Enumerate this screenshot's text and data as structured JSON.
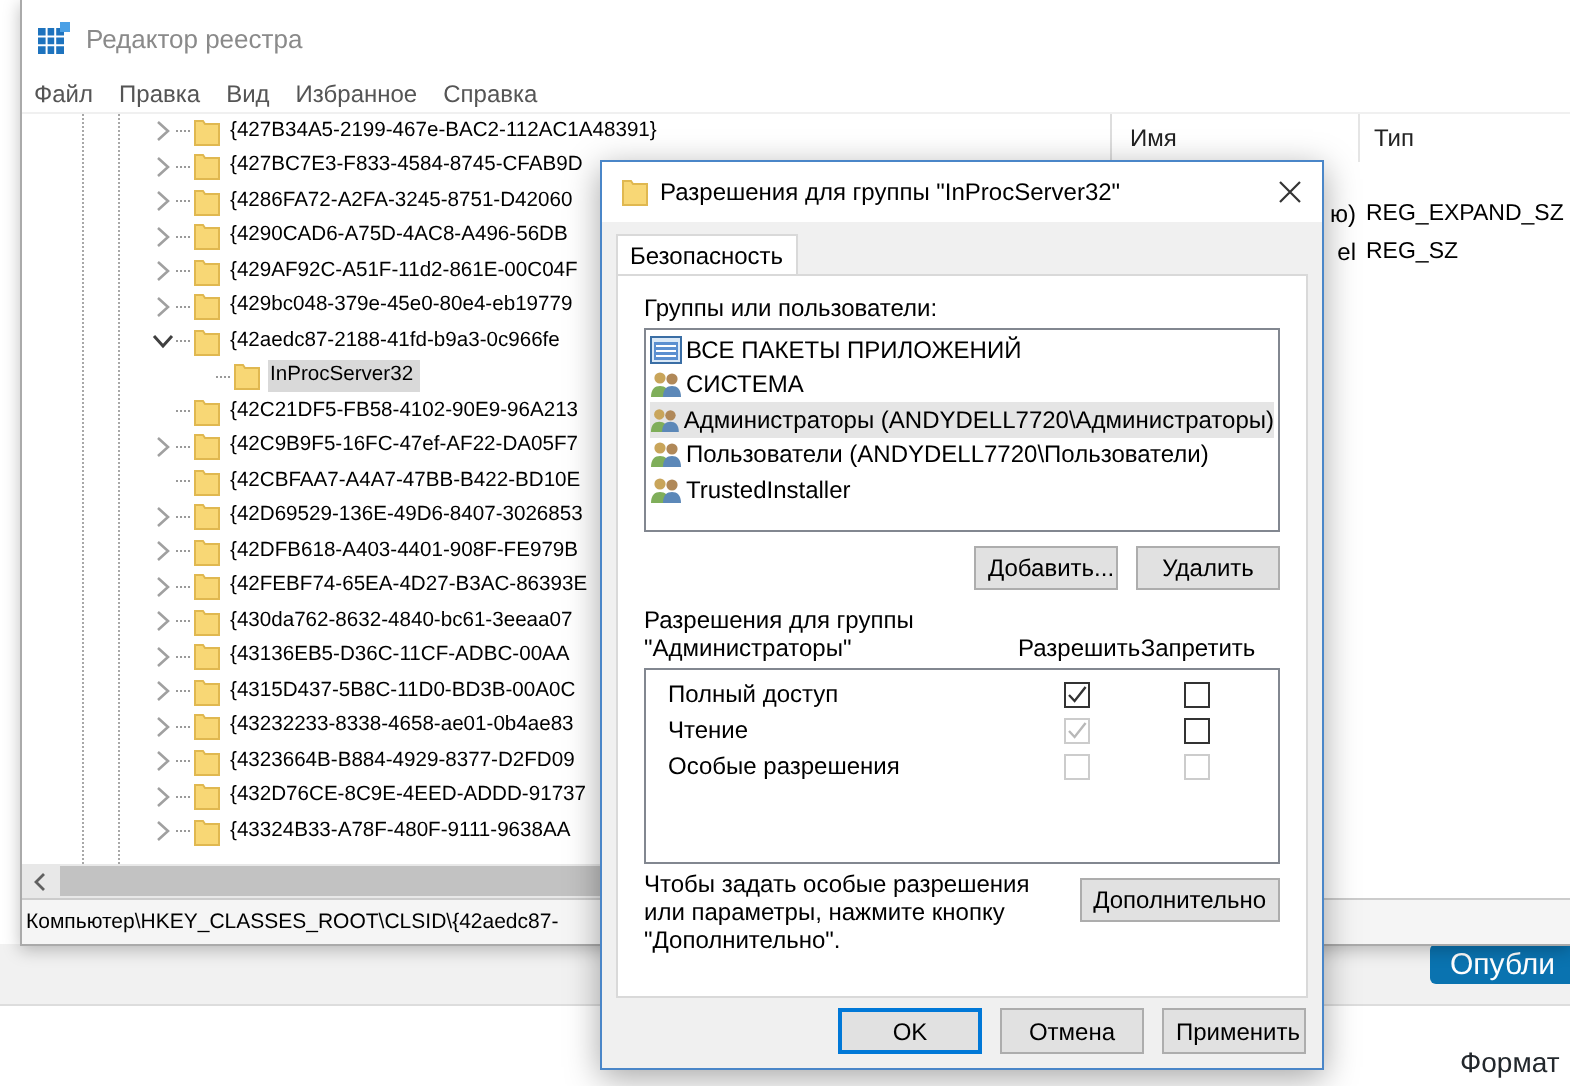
{
  "background_page": {
    "publish_button": "Опубли",
    "section_heading": "Формат"
  },
  "registry_window": {
    "title": "Редактор реестра",
    "menu": [
      "Файл",
      "Правка",
      "Вид",
      "Избранное",
      "Справка"
    ],
    "tree": [
      {
        "name": "{427B34A5-2199-467e-BAC2-112AC1A48391}",
        "expandable": true,
        "expanded": false,
        "selected": false
      },
      {
        "name": "{427BC7E3-F833-4584-8745-CFAB9D",
        "expandable": true,
        "expanded": false,
        "selected": false
      },
      {
        "name": "{4286FA72-A2FA-3245-8751-D42060",
        "expandable": true,
        "expanded": false,
        "selected": false
      },
      {
        "name": "{4290CAD6-A75D-4AC8-A496-56DB",
        "expandable": true,
        "expanded": false,
        "selected": false
      },
      {
        "name": "{429AF92C-A51F-11d2-861E-00C04F",
        "expandable": true,
        "expanded": false,
        "selected": false
      },
      {
        "name": "{429bc048-379e-45e0-80e4-eb19779",
        "expandable": true,
        "expanded": false,
        "selected": false
      },
      {
        "name": "{42aedc87-2188-41fd-b9a3-0c966fe",
        "expandable": true,
        "expanded": true,
        "selected": false,
        "children": [
          {
            "name": "InProcServer32",
            "expandable": false,
            "selected": true
          }
        ]
      },
      {
        "name": "{42C21DF5-FB58-4102-90E9-96A213",
        "expandable": false,
        "selected": false
      },
      {
        "name": "{42C9B9F5-16FC-47ef-AF22-DA05F7",
        "expandable": true,
        "expanded": false,
        "selected": false
      },
      {
        "name": "{42CBFAA7-A4A7-47BB-B422-BD10E",
        "expandable": false,
        "selected": false
      },
      {
        "name": "{42D69529-136E-49D6-8407-3026853",
        "expandable": true,
        "expanded": false,
        "selected": false
      },
      {
        "name": "{42DFB618-A403-4401-908F-FE979B",
        "expandable": true,
        "expanded": false,
        "selected": false
      },
      {
        "name": "{42FEBF74-65EA-4D27-B3AC-86393E",
        "expandable": true,
        "expanded": false,
        "selected": false
      },
      {
        "name": "{430da762-8632-4840-bc61-3eeaa07",
        "expandable": true,
        "expanded": false,
        "selected": false
      },
      {
        "name": "{43136EB5-D36C-11CF-ADBC-00AA",
        "expandable": true,
        "expanded": false,
        "selected": false
      },
      {
        "name": "{4315D437-5B8C-11D0-BD3B-00A0C",
        "expandable": true,
        "expanded": false,
        "selected": false
      },
      {
        "name": "{43232233-8338-4658-ae01-0b4ae83",
        "expandable": true,
        "expanded": false,
        "selected": false
      },
      {
        "name": "{4323664B-B884-4929-8377-D2FD09",
        "expandable": true,
        "expanded": false,
        "selected": false
      },
      {
        "name": "{432D76CE-8C9E-4EED-ADDD-91737",
        "expandable": true,
        "expanded": false,
        "selected": false
      },
      {
        "name": "{43324B33-A78F-480F-9111-9638AA",
        "expandable": true,
        "expanded": false,
        "selected": false
      }
    ],
    "values_table": {
      "columns": [
        "Имя",
        "Тип"
      ],
      "rows": [
        {
          "name": "ю)",
          "type": "REG_EXPAND_SZ"
        },
        {
          "name": "el",
          "type": "REG_SZ"
        }
      ]
    },
    "status_bar": "Компьютер\\HKEY_CLASSES_ROOT\\CLSID\\{42aedc87-"
  },
  "dialog": {
    "title": "Разрешения для группы \"InProcServer32\"",
    "tabs": [
      {
        "label": "Безопасность",
        "selected": true
      }
    ],
    "groups_label": "Группы или пользователи:",
    "principals": [
      {
        "name": "ВСЕ ПАКЕТЫ ПРИЛОЖЕНИЙ",
        "kind": "package",
        "selected": false
      },
      {
        "name": "СИСТЕМА",
        "kind": "group",
        "selected": false
      },
      {
        "name": "Администраторы (ANDYDELL7720\\Администраторы)",
        "kind": "group",
        "selected": true
      },
      {
        "name": "Пользователи (ANDYDELL7720\\Пользователи)",
        "kind": "group",
        "selected": false
      },
      {
        "name": "TrustedInstaller",
        "kind": "group",
        "selected": false
      }
    ],
    "principal_buttons": [
      "Добавить...",
      "Удалить"
    ],
    "permissions_label": "Разрешения для группы\n\"Администраторы\"",
    "permission_columns": [
      "Разрешить",
      "Запретить"
    ],
    "permissions": [
      {
        "label": "Полный доступ",
        "allow": {
          "checked": true,
          "disabled": false
        },
        "deny": {
          "checked": false,
          "disabled": false
        }
      },
      {
        "label": "Чтение",
        "allow": {
          "checked": true,
          "disabled": true
        },
        "deny": {
          "checked": false,
          "disabled": false
        }
      },
      {
        "label": "Особые разрешения",
        "allow": {
          "checked": false,
          "disabled": true
        },
        "deny": {
          "checked": false,
          "disabled": true
        }
      }
    ],
    "advanced_note": "Чтобы задать особые разрешения или параметры, нажмите кнопку \"Дополнительно\".",
    "advanced_button": "Дополнительно",
    "buttons": [
      {
        "label": "OK",
        "default": true
      },
      {
        "label": "Отмена",
        "default": false
      },
      {
        "label": "Применить",
        "default": false
      }
    ]
  }
}
